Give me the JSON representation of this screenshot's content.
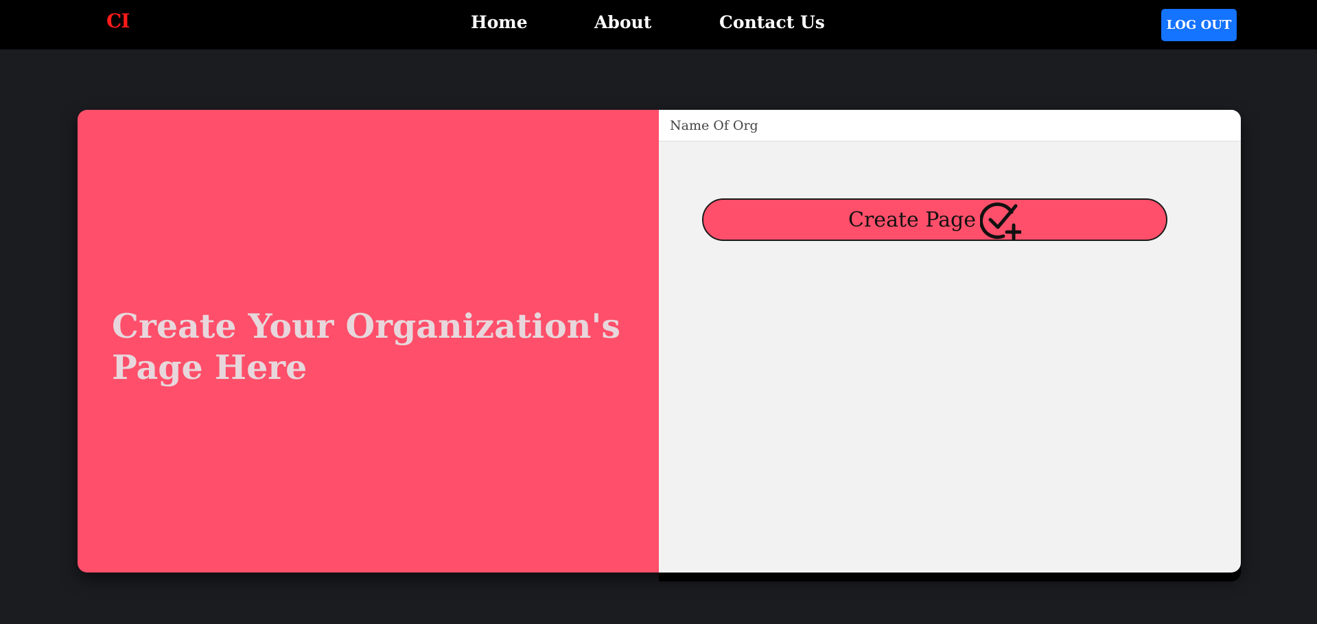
{
  "header": {
    "logo": "CI",
    "nav": [
      "Home",
      "About",
      "Contact Us"
    ],
    "logout_label": "LOG OUT"
  },
  "hero": {
    "title": "Create Your Organization's Page Here"
  },
  "form": {
    "org_name_placeholder": "Name Of Org",
    "org_name_value": "",
    "create_button_label": "Create Page",
    "create_button_icon": "check-circle-plus-icon"
  },
  "colors": {
    "topbar": "#000000",
    "background": "#1b1c20",
    "accent": "#ff4f6a",
    "logo": "#ff1a1a",
    "logout_button": "#1473ff",
    "form_panel": "#f2f2f2"
  }
}
